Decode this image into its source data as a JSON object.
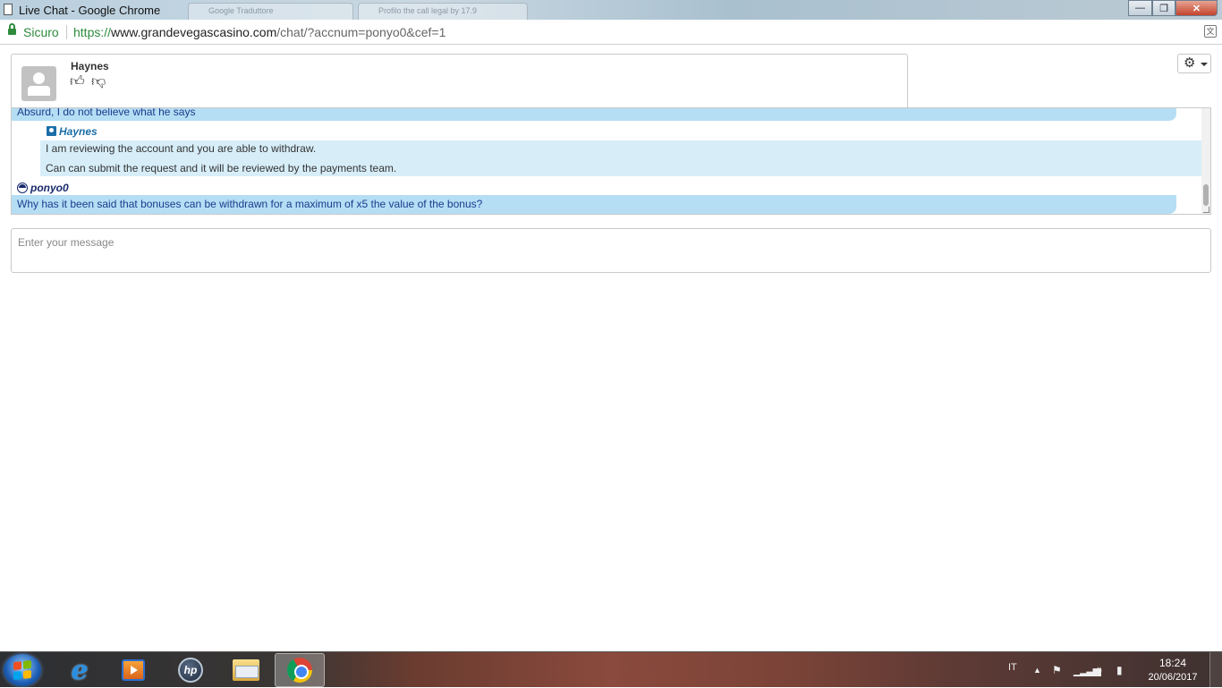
{
  "window": {
    "title": "Live Chat - Google Chrome",
    "ghost_tab_1": "Google Traduttore",
    "ghost_tab_2": "Profilo the call legal by 17.9"
  },
  "address_bar": {
    "secure_label": "Sicuro",
    "url_protocol": "https://",
    "url_host": "www.grandevegascasino.com",
    "url_path": "/chat/?accnum=ponyo0&cef=1"
  },
  "chat": {
    "agent_name": "Haynes",
    "messages": [
      {
        "from": "user",
        "text": "Absurd, I do not believe what he says"
      },
      {
        "from": "agent",
        "sender": "Haynes",
        "lines": [
          "I am reviewing the account and you are able to withdraw.",
          "Can can submit the request and it will be reviewed by the payments team."
        ]
      },
      {
        "from": "user",
        "sender": "ponyo0",
        "text": "Why has it been said that bonuses can be withdrawn for a maximum of x5 the value of the bonus?"
      }
    ],
    "input_placeholder": "Enter your message"
  },
  "taskbar": {
    "apps": [
      "internet-explorer",
      "windows-media-player",
      "hp-support-assistant",
      "windows-explorer",
      "google-chrome"
    ],
    "active_app": "google-chrome",
    "language": "IT",
    "time": "18:24",
    "date": "20/06/2017"
  },
  "colors": {
    "secure_green": "#2e8b3d",
    "user_bubble": "#b5def5",
    "agent_bubble": "#d7eef9",
    "agent_name_blue": "#1b6ea8"
  }
}
